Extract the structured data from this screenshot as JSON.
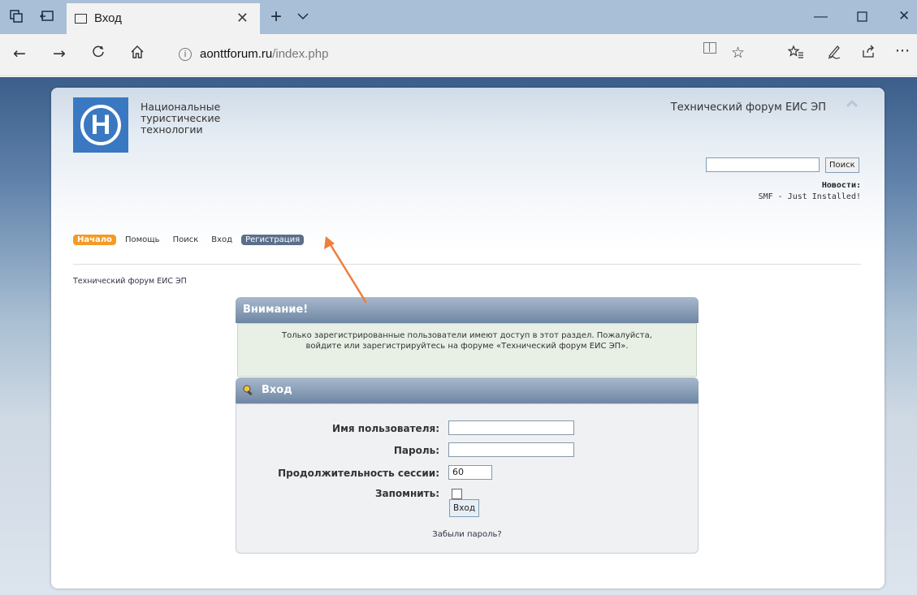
{
  "browser": {
    "tab_title": "Вход",
    "url_host": "aonttforum.ru",
    "url_path": "/index.php"
  },
  "header": {
    "org_line1": "Национальные",
    "org_line2": "туристические",
    "org_line3": "технологии",
    "logo_letter": "Н",
    "forum_title": "Технический форум ЕИС ЭП",
    "search_button": "Поиск",
    "news_label": "Новости:",
    "news_text": "SMF - Just Installed!"
  },
  "menu": {
    "home": "Начало",
    "help": "Помощь",
    "search": "Поиск",
    "login": "Вход",
    "register": "Регистрация"
  },
  "breadcrumb": "Технический форум ЕИС ЭП",
  "notice": {
    "title": "Внимание!",
    "text": "Только зарегистрированные пользователи имеют доступ в этот раздел. Пожалуйста, войдите или зарегистрируйтесь на форуме «Технический форум ЕИС ЭП»."
  },
  "login": {
    "title": "Вход",
    "username_label": "Имя пользователя:",
    "password_label": "Пароль:",
    "session_label": "Продолжительность сессии:",
    "session_value": "60",
    "remember_label": "Запомнить:",
    "submit": "Вход",
    "forgot": "Забыли пароль?"
  },
  "colors": {
    "accent_orange": "#f39a26",
    "bar_blue": "#6e86a3",
    "annotation_arrow": "#ee7f3a"
  }
}
